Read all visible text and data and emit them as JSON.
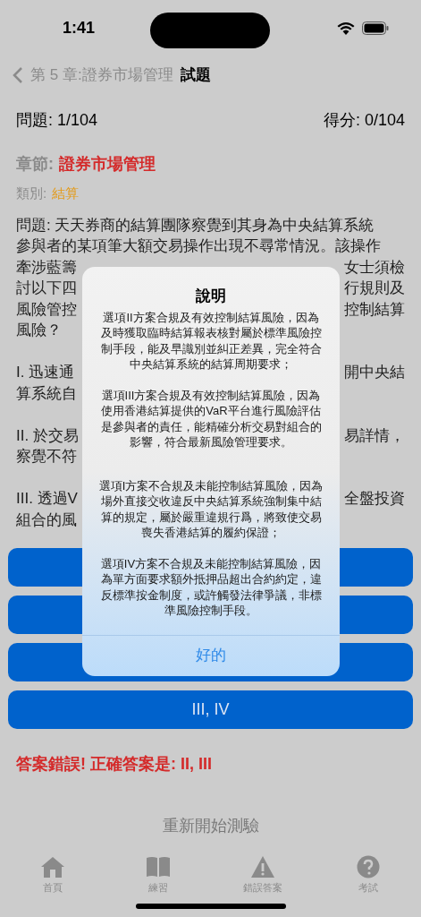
{
  "status_bar": {
    "time": "1:41"
  },
  "nav": {
    "back_label": "第 5 章:證券市場管理",
    "title": "試題"
  },
  "progress": {
    "question": "問題: 1/104",
    "score": "得分: 0/104"
  },
  "chapter": {
    "label": "章節:",
    "value": "證券市場管理"
  },
  "category": {
    "label": "類別:",
    "value": "結算"
  },
  "question_lines": [
    {
      "left": "問題: 天天券商的結算團隊察覺到其身為中央結算系統"
    },
    {
      "left": "參與者的某項筆大額交易操作出現不尋常情況。該操作"
    },
    {
      "left": "牽涉藍籌",
      "right": "女士須檢"
    },
    {
      "left": "討以下四",
      "right": "行規則及"
    },
    {
      "left": "風險管控",
      "right": "控制結算"
    },
    {
      "left": "風險？"
    },
    {
      "kind": "gap"
    },
    {
      "left": "I. 迅速通",
      "right": "開中央結"
    },
    {
      "left": "算系統自"
    },
    {
      "kind": "gap"
    },
    {
      "left": "II. 於交易",
      "right": "易詳情，"
    },
    {
      "left": "察覺不符"
    },
    {
      "kind": "gap"
    },
    {
      "left": "III. 透過V",
      "right": "全盤投資"
    },
    {
      "left": "組合的風"
    }
  ],
  "options": [
    {
      "label": "III, IV"
    }
  ],
  "result": "答案錯誤! 正確答案是: II, III",
  "restart": "重新開始測驗",
  "tabs": [
    {
      "kind": "home",
      "label": "首頁"
    },
    {
      "kind": "book",
      "label": "練習"
    },
    {
      "kind": "warning",
      "label": "錯誤答案"
    },
    {
      "kind": "help",
      "label": "考試"
    }
  ],
  "alert": {
    "title": "說明",
    "paragraphs": [
      "選項II方案合規及有效控制結算風險，因為及時獲取臨時結算報表核對屬於標準風險控制手段，能及早識別並糾正差異，完全符合中央結算系統的結算周期要求；",
      "選項III方案合規及有效控制結算風險，因為使用香港結算提供的VaR平台進行風險評估是參與者的責任，能精確分析交易對組合的影響，符合最新風險管理要求。",
      "選項I方案不合規及未能控制結算風險，因為場外直接交收違反中央結算系統強制集中結算的規定，屬於嚴重違規行爲，將致使交易喪失香港結算的履約保證；",
      "選項IV方案不合規及未能控制結算風險，因為單方面要求額外抵押品超出合約約定，違反標準按金制度，或許觸發法律爭議，非標準風險控制手段。"
    ],
    "button": "好的"
  }
}
